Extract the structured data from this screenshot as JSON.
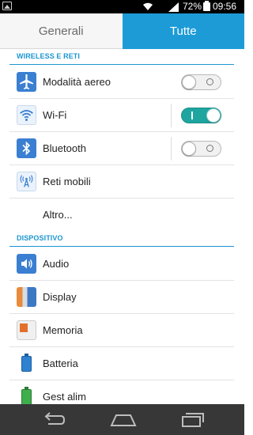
{
  "status_bar": {
    "battery_percent": "72%",
    "time": "09:56",
    "icons": [
      "notification-image-icon",
      "wifi-icon",
      "signal-icon",
      "battery-icon"
    ]
  },
  "tabs": [
    {
      "label": "Generali",
      "selected": false
    },
    {
      "label": "Tutte",
      "selected": true
    }
  ],
  "sections": {
    "wireless": {
      "title": "WIRELESS E RETI",
      "items": [
        {
          "label": "Modalità aereo",
          "icon": "airplane-icon",
          "toggle": "off"
        },
        {
          "label": "Wi-Fi",
          "icon": "wifi-icon",
          "toggle": "on"
        },
        {
          "label": "Bluetooth",
          "icon": "bluetooth-icon",
          "toggle": "off"
        },
        {
          "label": "Reti mobili",
          "icon": "mobile-network-icon"
        },
        {
          "label": "Altro..."
        }
      ]
    },
    "device": {
      "title": "DISPOSITIVO",
      "items": [
        {
          "label": "Audio",
          "icon": "speaker-icon"
        },
        {
          "label": "Display",
          "icon": "display-icon"
        },
        {
          "label": "Memoria",
          "icon": "storage-icon"
        },
        {
          "label": "Batteria",
          "icon": "battery-icon"
        },
        {
          "label": "Gest alim",
          "icon": "power-management-icon"
        }
      ]
    }
  },
  "nav_bar": {
    "buttons": [
      "back-icon",
      "home-icon",
      "recent-apps-icon"
    ]
  },
  "colors": {
    "accent": "#1d9bd6",
    "toggle_on": "#1fa5a0",
    "nav_bar": "#373737"
  }
}
